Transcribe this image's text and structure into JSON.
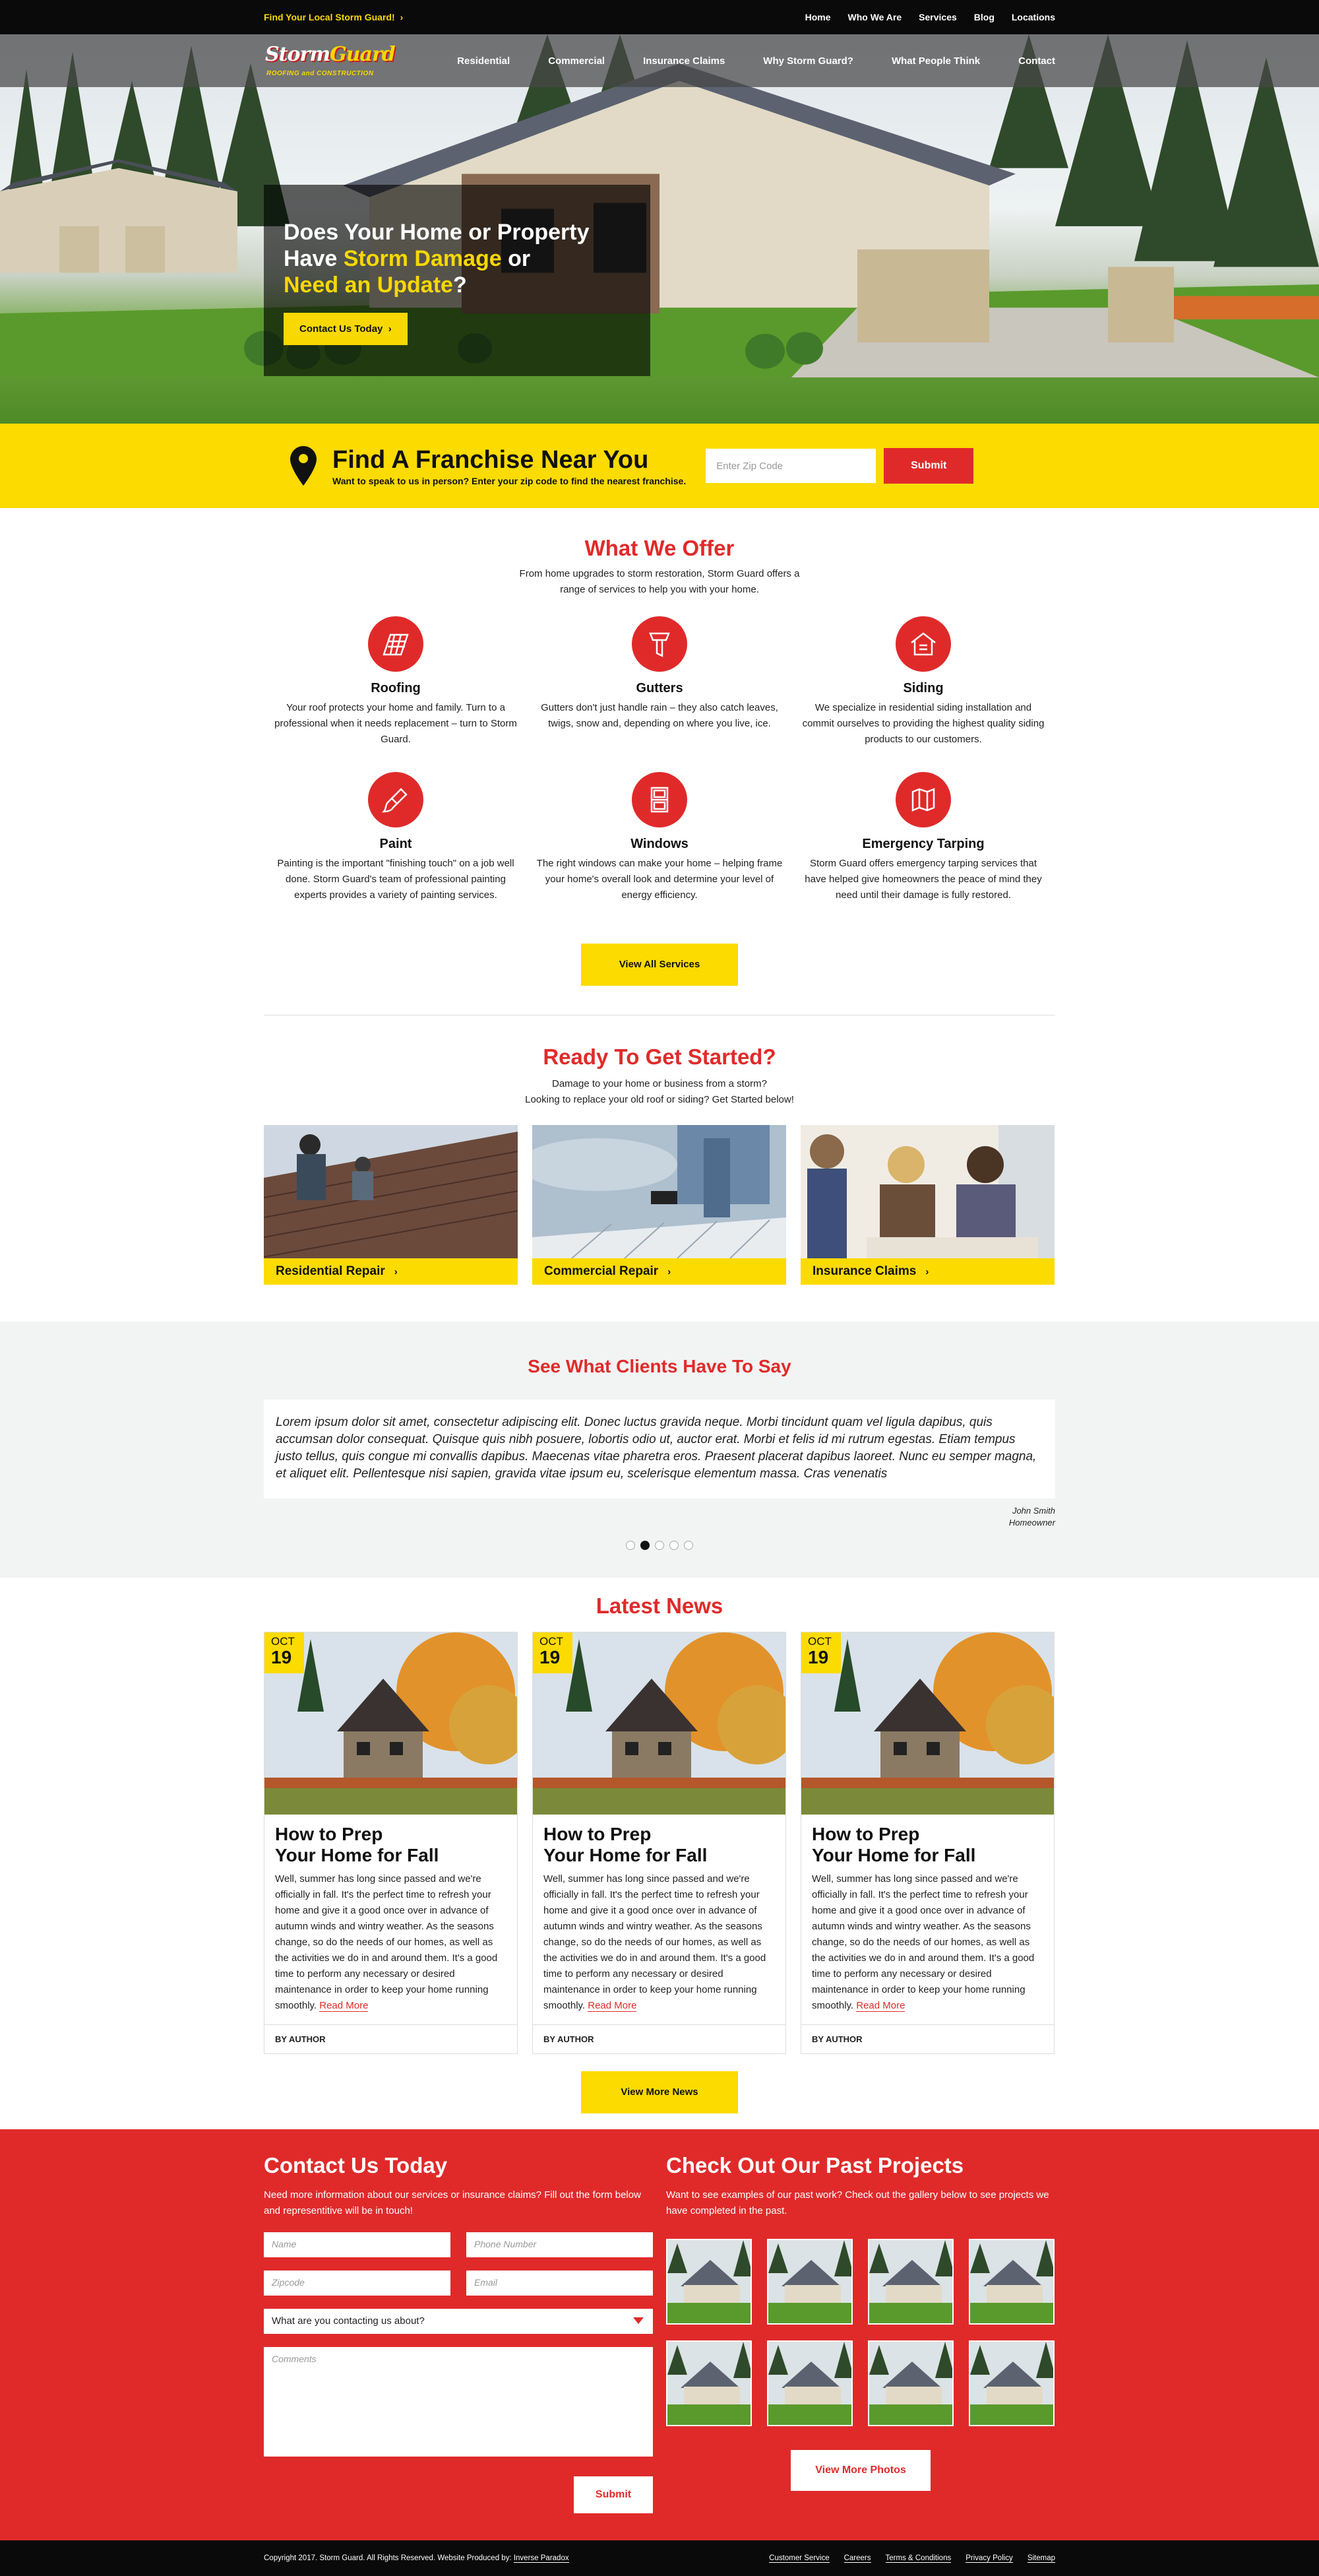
{
  "topbar": {
    "find_label": "Find Your Local Storm Guard!",
    "links": [
      "Home",
      "Who We Are",
      "Services",
      "Blog",
      "Locations"
    ]
  },
  "logo": {
    "line1_a": "Storm",
    "line1_b": "Guard",
    "line2": "ROOFING and CONSTRUCTION"
  },
  "nav": [
    "Residential",
    "Commercial",
    "Insurance Claims",
    "Why Storm Guard?",
    "What People Think",
    "Contact"
  ],
  "hero": {
    "line1": "Does Your Home or Property",
    "line2_a": "Have ",
    "line2_b": "Storm Damage",
    "line2_c": " or",
    "line3_a": "Need an Update",
    "line3_b": "?",
    "cta": "Contact Us Today"
  },
  "franchise": {
    "title": "Find A Franchise Near You",
    "subtitle": "Want to speak to us in person? Enter your zip code to find the nearest franchise.",
    "zip_placeholder": "Enter Zip Code",
    "submit": "Submit"
  },
  "offer": {
    "title": "What We Offer",
    "intro": "From home upgrades to storm restoration, Storm Guard offers a range of services to help you with your home.",
    "services": [
      {
        "title": "Roofing",
        "text": "Your roof protects your home and family. Turn to a professional when it needs replacement – turn to Storm Guard.",
        "icon": "roofing-icon"
      },
      {
        "title": "Gutters",
        "text": "Gutters don't just handle rain – they also catch leaves, twigs, snow and, depending on where you live, ice.",
        "icon": "gutters-icon"
      },
      {
        "title": "Siding",
        "text": "We specialize in residential siding installation and commit ourselves to providing the highest quality siding products to our customers.",
        "icon": "siding-icon"
      },
      {
        "title": "Paint",
        "text": "Painting is the important \"finishing touch\" on a job well done. Storm Guard's team of professional painting experts provides a variety of painting services.",
        "icon": "paint-icon"
      },
      {
        "title": "Windows",
        "text": "The right windows can make your home – helping frame your home's overall look and determine your level of energy efficiency.",
        "icon": "windows-icon"
      },
      {
        "title": "Emergency Tarping",
        "text": "Storm Guard offers emergency tarping services that have helped give homeowners the peace of mind they need until their damage is fully restored.",
        "icon": "tarping-icon"
      }
    ],
    "button": "View All Services"
  },
  "started": {
    "title": "Ready To Get Started?",
    "line1": "Damage to your home or business from a storm?",
    "line2": "Looking to replace your old roof or siding? Get Started below!",
    "cards": [
      "Residential Repair",
      "Commercial Repair",
      "Insurance Claims"
    ]
  },
  "testimonials": {
    "title": "See What Clients Have To Say",
    "quote": "Lorem ipsum dolor sit amet, consectetur adipiscing elit. Donec luctus gravida neque. Morbi tincidunt quam vel ligula dapibus, quis accumsan dolor consequat. Quisque quis nibh posuere, lobortis odio ut, auctor erat. Morbi et felis id mi rutrum egestas. Etiam tempus justo tellus, quis congue mi convallis dapibus. Maecenas vitae pharetra eros. Praesent placerat dapibus laoreet. Nunc eu semper magna, et aliquet elit. Pellentesque nisi sapien, gravida vitae ipsum eu, scelerisque elementum massa. Cras venenatis",
    "name": "John Smith",
    "role": "Homeowner",
    "slides": 5,
    "active_slide": 2
  },
  "news": {
    "title": "Latest News",
    "posts": [
      {
        "month": "OCT",
        "day": "19",
        "title1": "How to Prep",
        "title2": "Your Home for Fall",
        "body": "Well, summer has long since passed and we're officially in fall. It's the perfect time to refresh your home and give it a good once over in advance of autumn winds and wintry weather. As the seasons change, so do the needs of our homes, as well as the activities we do in and around them. It's a good time to perform any necessary or desired maintenance in order to keep your home running smoothly.",
        "read_more": "Read More",
        "author": "BY AUTHOR"
      },
      {
        "month": "OCT",
        "day": "19",
        "title1": "How to Prep",
        "title2": "Your Home for Fall",
        "body": "Well, summer has long since passed and we're officially in fall. It's the perfect time to refresh your home and give it a good once over in advance of autumn winds and wintry weather. As the seasons change, so do the needs of our homes, as well as the activities we do in and around them. It's a good time to perform any necessary or desired maintenance in order to keep your home running smoothly.",
        "read_more": "Read More",
        "author": "BY AUTHOR"
      },
      {
        "month": "OCT",
        "day": "19",
        "title1": "How to Prep",
        "title2": "Your Home for Fall",
        "body": "Well, summer has long since passed and we're officially in fall. It's the perfect time to refresh your home and give it a good once over in advance of autumn winds and wintry weather. As the seasons change, so do the needs of our homes, as well as the activities we do in and around them. It's a good time to perform any necessary or desired maintenance in order to keep your home running smoothly.",
        "read_more": "Read More",
        "author": "BY AUTHOR"
      }
    ],
    "button": "View More News"
  },
  "contact": {
    "title": "Contact Us Today",
    "text": "Need more information about our services or insurance claims? Fill out the form below and representitive will be in touch!",
    "name_ph": "Name",
    "phone_ph": "Phone Number",
    "zip_ph": "Zipcode",
    "email_ph": "Email",
    "select_value": "What are you contacting us about?",
    "comments_ph": "Comments",
    "submit": "Submit"
  },
  "projects": {
    "title": "Check Out Our Past Projects",
    "text": "Want to see examples of our past work? Check out the gallery below to see projects we have completed in the past.",
    "button": "View More Photos"
  },
  "footer": {
    "copyright": "Copyright 2017. Storm Guard. All Rights Reserved. Website Produced by: ",
    "producer": "Inverse Paradox",
    "links": [
      "Customer Service",
      "Careers",
      "Terms & Conditions",
      "Privacy Policy",
      "Sitemap"
    ]
  },
  "colors": {
    "brand_red": "#e02a2a",
    "brand_yellow": "#fbdb00",
    "dark": "#0a0a0a"
  }
}
